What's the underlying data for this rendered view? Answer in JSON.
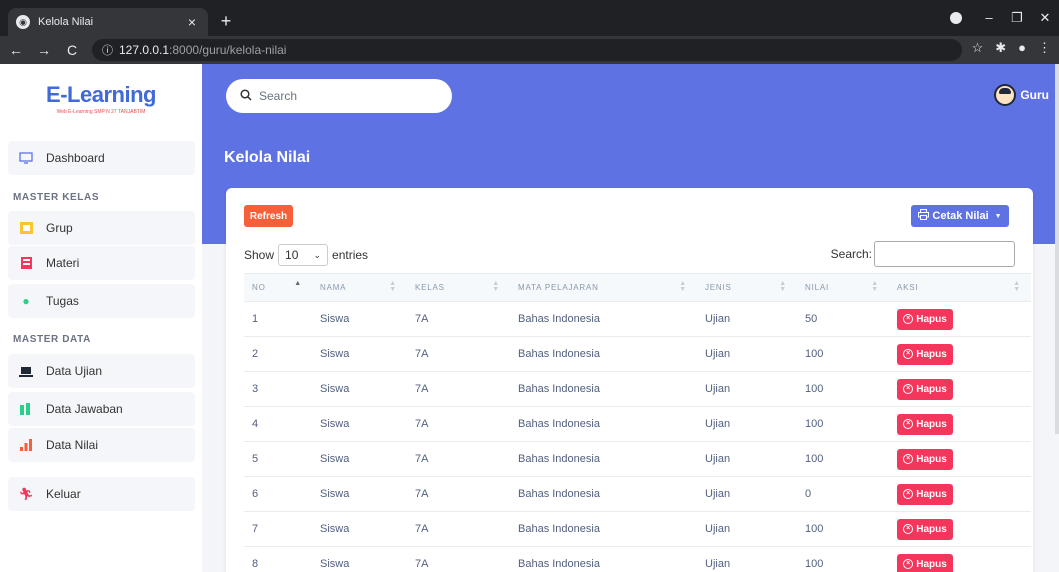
{
  "browser": {
    "tab_title": "Kelola Nilai",
    "url_host": "127.0.0.1",
    "url_path": ":8000/guru/kelola-nilai"
  },
  "brand": {
    "title": "E-Learning",
    "subtitle": "Web E-Learning SMP N 27 TANJABTIM"
  },
  "sidebar": {
    "dashboard": "Dashboard",
    "heading_kelas": "MASTER KELAS",
    "grup": "Grup",
    "materi": "Materi",
    "tugas": "Tugas",
    "heading_data": "MASTER DATA",
    "data_ujian": "Data Ujian",
    "data_jawaban": "Data Jawaban",
    "data_nilai": "Data Nilai",
    "keluar": "Keluar"
  },
  "header": {
    "search_placeholder": "Search",
    "user_name": "Guru",
    "page_title": "Kelola Nilai"
  },
  "card": {
    "refresh_label": "Refresh",
    "cetak_label": "Cetak Nilai",
    "show_label": "Show",
    "entries_value": "10",
    "entries_label": "entries",
    "search_label": "Search:"
  },
  "table": {
    "columns": [
      "NO",
      "NAMA",
      "KELAS",
      "MATA PELAJARAN",
      "JENIS",
      "NILAI",
      "AKSI"
    ],
    "delete_label": "Hapus",
    "rows": [
      [
        "1",
        "Siswa",
        "7A",
        "Bahas Indonesia",
        "Ujian",
        "50"
      ],
      [
        "2",
        "Siswa",
        "7A",
        "Bahas Indonesia",
        "Ujian",
        "100"
      ],
      [
        "3",
        "Siswa",
        "7A",
        "Bahas Indonesia",
        "Ujian",
        "100"
      ],
      [
        "4",
        "Siswa",
        "7A",
        "Bahas Indonesia",
        "Ujian",
        "100"
      ],
      [
        "5",
        "Siswa",
        "7A",
        "Bahas Indonesia",
        "Ujian",
        "100"
      ],
      [
        "6",
        "Siswa",
        "7A",
        "Bahas Indonesia",
        "Ujian",
        "0"
      ],
      [
        "7",
        "Siswa",
        "7A",
        "Bahas Indonesia",
        "Ujian",
        "100"
      ],
      [
        "8",
        "Siswa",
        "7A",
        "Bahas Indonesia",
        "Ujian",
        "100"
      ]
    ]
  },
  "colors": {
    "accent": "#5e72e4",
    "danger": "#f5365c",
    "refresh": "#f5603a"
  }
}
